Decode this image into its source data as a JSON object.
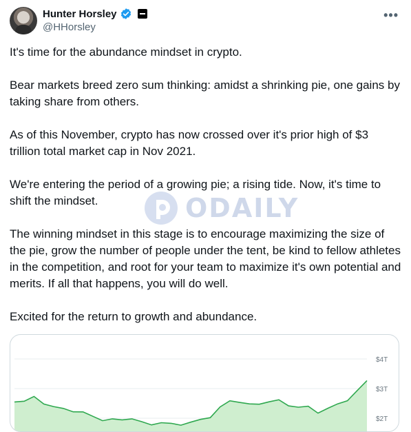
{
  "author": {
    "display_name": "Hunter Horsley",
    "handle": "@HHorsley",
    "avatar_icon": "avatar",
    "verified_icon": "verified-badge-icon",
    "affiliation_icon": "affiliation-badge-icon"
  },
  "menu": {
    "more_label": "•••"
  },
  "tweet": {
    "paragraphs": [
      "It's time for the abundance mindset in crypto.",
      "Bear markets breed zero sum thinking: amidst a shrinking pie, one gains by taking share from others.",
      "As of this November, crypto has now crossed over it's prior high of $3 trillion total market cap in Nov 2021.",
      "We're entering the period of a growing pie; a rising tide. Now, it's time to shift the mindset.",
      "The winning mindset in this stage is to encourage maximizing the size of the pie, grow the number of people under the tent, be kind to fellow athletes in the competition, and root for your team to maximize it's own potential and merits. If all that happens, you will do well.",
      "Excited for the return to growth and abundance."
    ]
  },
  "watermark": {
    "text": "ODAILY"
  },
  "colors": {
    "accent": "#1d9bf0",
    "chart_line": "#2fa84f",
    "chart_fill": "#cfeecf"
  },
  "chart_data": {
    "type": "area",
    "ylabel": "",
    "y_tick_labels": [
      "$4T",
      "$3T",
      "$2T"
    ],
    "y_ticks": [
      4,
      3,
      2
    ],
    "ylim": [
      1.8,
      4.3
    ],
    "series": [
      {
        "values": [
          2.55,
          2.6,
          2.7,
          2.5,
          2.4,
          2.3,
          2.25,
          2.2,
          2.05,
          1.95,
          1.95,
          1.95,
          2.0,
          1.85,
          1.8,
          1.85,
          1.8,
          1.8,
          1.85,
          1.95,
          2.05,
          2.35,
          2.6,
          2.55,
          2.45,
          2.5,
          2.55,
          2.6,
          2.45,
          2.35,
          2.4,
          2.2,
          2.3,
          2.5,
          2.6,
          2.9,
          3.3
        ]
      }
    ]
  }
}
